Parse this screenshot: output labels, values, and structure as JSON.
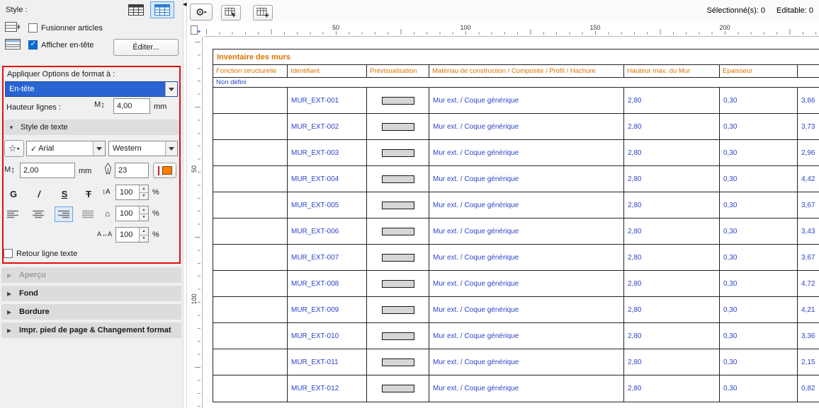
{
  "colors": {
    "accent_orange": "#dc7300",
    "data_blue": "#2e44cb",
    "highlight_red": "#e20d0d",
    "selection_blue": "#2a64d2",
    "checkbox_blue": "#0d6cd1",
    "swatch_orange": "#ff7d00"
  },
  "icons": {
    "gear": "⚙",
    "small_arrow": "▸",
    "star": "☆",
    "letter_m": "M",
    "updown": "↕",
    "tri_down": "▼",
    "tri_right": "▶",
    "collapse_left": "◀",
    "line_spacing": "↕A",
    "house": "⌂",
    "letter_spacing": "A↔A",
    "spin_up": "▲",
    "spin_down": "▼"
  },
  "panel": {
    "style_label": "Style :",
    "fusionner_label": "Fusionner articles",
    "afficher_label": "Afficher en-tête",
    "editer_button": "Éditer...",
    "apply_label": "Appliquer Options de format à :",
    "apply_value": "En-tête",
    "hauteur_label": "Hauteur lignes :",
    "hauteur_value": "4,00",
    "unit_mm": "mm",
    "section_text_style": "Style de texte",
    "font_check": "✓",
    "font_name": "Arial",
    "script_value": "Western",
    "size_value": "2,00",
    "pen_value": "23",
    "bold_label": "G",
    "italic_label": "/",
    "underline_label": "S",
    "strike_label": "T",
    "line_spacing_value": "100",
    "char_width_value": "100",
    "letter_spacing_value": "100",
    "percent": "%",
    "wrap_label": "Retour ligne texte",
    "section_apercu": "Aperçu",
    "section_fond": "Fond",
    "section_bordure": "Bordure",
    "section_impr": "Impr. pied de page & Changement format"
  },
  "toolbar": {
    "selected_count": "Sélectionné(s): 0",
    "editable_count": "Editable: 0"
  },
  "rulers": {
    "horizontal": [
      "50",
      "100",
      "150",
      "200"
    ],
    "vertical": [
      "50",
      "100"
    ]
  },
  "table": {
    "title": "Inventaire des murs",
    "columns": [
      "Fonction structurelle",
      "Identifiant",
      "Prévisualisation",
      "Matériau de construction / Composite / Profil / Hachure",
      "Hauteur max. du Mur",
      "Epaisseur"
    ],
    "group_label": "Non défini",
    "rows": [
      {
        "id": "MUR_EXT-001",
        "material": "Mur ext. / Coque générique",
        "max_height": "2,80",
        "thickness": "0,30",
        "extra": "3,66"
      },
      {
        "id": "MUR_EXT-002",
        "material": "Mur ext. / Coque générique",
        "max_height": "2,80",
        "thickness": "0,30",
        "extra": "3,73"
      },
      {
        "id": "MUR_EXT-003",
        "material": "Mur ext. / Coque générique",
        "max_height": "2,80",
        "thickness": "0,30",
        "extra": "2,96"
      },
      {
        "id": "MUR_EXT-004",
        "material": "Mur ext. / Coque générique",
        "max_height": "2,80",
        "thickness": "0,30",
        "extra": "4,42"
      },
      {
        "id": "MUR_EXT-005",
        "material": "Mur ext. / Coque générique",
        "max_height": "2,80",
        "thickness": "0,30",
        "extra": "3,67"
      },
      {
        "id": "MUR_EXT-006",
        "material": "Mur ext. / Coque générique",
        "max_height": "2,80",
        "thickness": "0,30",
        "extra": "3,43"
      },
      {
        "id": "MUR_EXT-007",
        "material": "Mur ext. / Coque générique",
        "max_height": "2,80",
        "thickness": "0,30",
        "extra": "3,67"
      },
      {
        "id": "MUR_EXT-008",
        "material": "Mur ext. / Coque générique",
        "max_height": "2,80",
        "thickness": "0,30",
        "extra": "4,72"
      },
      {
        "id": "MUR_EXT-009",
        "material": "Mur ext. / Coque générique",
        "max_height": "2,80",
        "thickness": "0,30",
        "extra": "4,21"
      },
      {
        "id": "MUR_EXT-010",
        "material": "Mur ext. / Coque générique",
        "max_height": "2,80",
        "thickness": "0,30",
        "extra": "3,36"
      },
      {
        "id": "MUR_EXT-011",
        "material": "Mur ext. / Coque générique",
        "max_height": "2,80",
        "thickness": "0,30",
        "extra": "2,15"
      },
      {
        "id": "MUR_EXT-012",
        "material": "Mur ext. / Coque générique",
        "max_height": "2,80",
        "thickness": "0,30",
        "extra": "0,82"
      }
    ]
  }
}
